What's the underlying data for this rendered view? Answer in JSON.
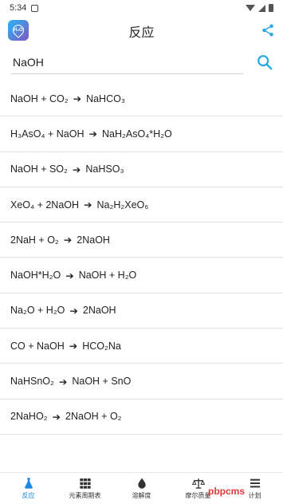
{
  "status": {
    "time": "5:34"
  },
  "header": {
    "title": "反应"
  },
  "search": {
    "value": "NaOH"
  },
  "reactions": [
    {
      "left": "NaOH + CO₂",
      "right": "NaHCO₃"
    },
    {
      "left": "H₃AsO₄ + NaOH",
      "right": "NaH₂AsO₄*H₂O"
    },
    {
      "left": "NaOH + SO₂",
      "right": "NaHSO₃"
    },
    {
      "left": "XeO₄ + 2NaOH",
      "right": "Na₂H₂XeO₆"
    },
    {
      "left": "2NaH + O₂",
      "right": "2NaOH"
    },
    {
      "left": "NaOH*H₂O",
      "right": "NaOH + H₂O"
    },
    {
      "left": "Na₂O + H₂O",
      "right": "2NaOH"
    },
    {
      "left": "CO + NaOH",
      "right": "HCO₂Na"
    },
    {
      "left": "NaHSnO₂",
      "right": "NaOH + SnO"
    },
    {
      "left": "2NaHO₂",
      "right": "2NaOH + O₂"
    }
  ],
  "arrow": "➔",
  "nav": [
    {
      "label": "反应",
      "icon": "flask-icon",
      "active": true
    },
    {
      "label": "元素周期表",
      "icon": "grid-icon",
      "active": false
    },
    {
      "label": "溶解度",
      "icon": "drop-icon",
      "active": false
    },
    {
      "label": "摩尔质量",
      "icon": "scale-icon",
      "active": false
    },
    {
      "label": "计划",
      "icon": "menu-icon",
      "active": false
    }
  ],
  "watermark": "pbpcms",
  "colors": {
    "accent": "#1e88e5",
    "search_icon": "#29a8e0",
    "share_icon": "#29a8e0"
  }
}
